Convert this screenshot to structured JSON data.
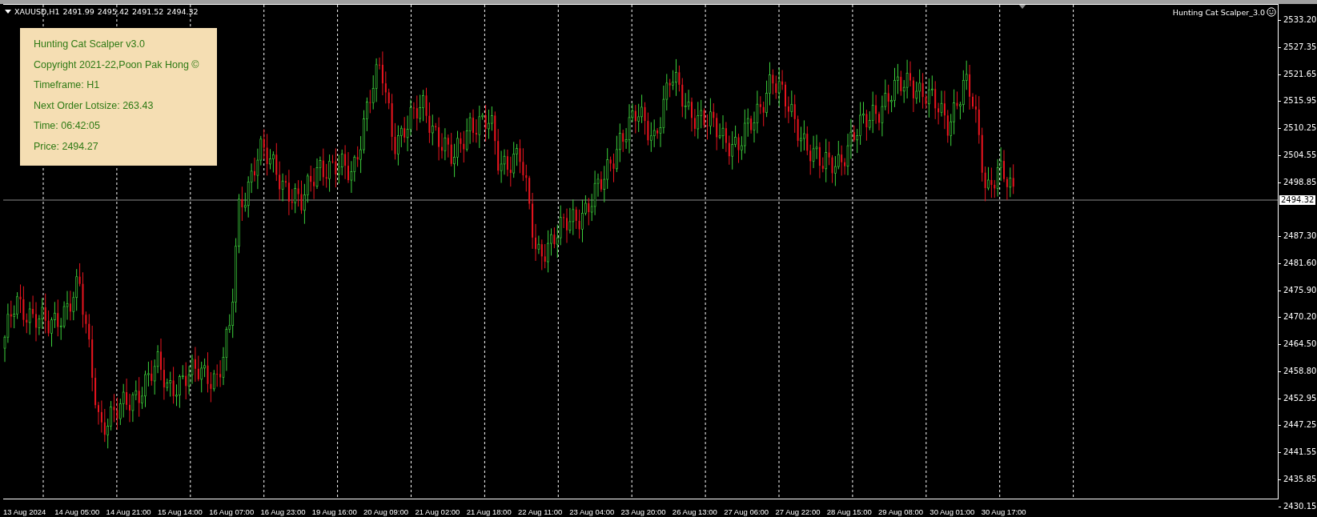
{
  "header": {
    "symbol": "XAUUSD,H1",
    "ohlc": [
      "2491.99",
      "2495.42",
      "2491.52",
      "2494.32"
    ]
  },
  "info_panel": {
    "lines": [
      "Hunting Cat Scalper v3.0",
      "Copyright 2021-22,Poon Pak Hong ©",
      "Timeframe: H1",
      "Next Order Lotsize: 263.43",
      "Time: 06:42:05",
      "Price: 2494.27"
    ]
  },
  "indicator": {
    "name": "Hunting Cat Scalper_3.0"
  },
  "price_axis": {
    "labels": [
      "2533.20",
      "2527.35",
      "2521.65",
      "2515.95",
      "2510.25",
      "2504.55",
      "2498.85",
      "2487.30",
      "2481.60",
      "2475.90",
      "2470.20",
      "2464.50",
      "2458.80",
      "2452.95",
      "2447.25",
      "2441.55",
      "2435.85",
      "2430.15"
    ],
    "current_price": "2494.32"
  },
  "time_axis": {
    "labels": [
      "13 Aug 2024",
      "14 Aug 05:00",
      "14 Aug 21:00",
      "15 Aug 14:00",
      "16 Aug 07:00",
      "16 Aug 23:00",
      "19 Aug 16:00",
      "20 Aug 09:00",
      "21 Aug 02:00",
      "21 Aug 18:00",
      "22 Aug 11:00",
      "23 Aug 04:00",
      "23 Aug 20:00",
      "26 Aug 13:00",
      "27 Aug 06:00",
      "27 Aug 22:00",
      "28 Aug 15:00",
      "29 Aug 08:00",
      "30 Aug 01:00",
      "30 Aug 17:00"
    ]
  }
}
